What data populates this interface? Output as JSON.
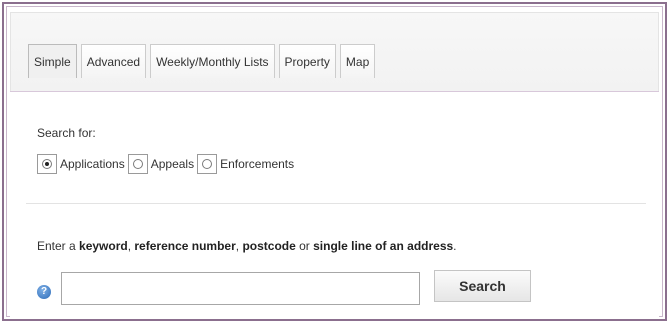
{
  "tabs": [
    {
      "label": "Simple",
      "active": true
    },
    {
      "label": "Advanced",
      "active": false
    },
    {
      "label": "Weekly/Monthly Lists",
      "active": false
    },
    {
      "label": "Property",
      "active": false
    },
    {
      "label": "Map",
      "active": false
    }
  ],
  "search_for": {
    "label": "Search for:",
    "options": [
      {
        "label": "Applications",
        "selected": true
      },
      {
        "label": "Appeals",
        "selected": false
      },
      {
        "label": "Enforcements",
        "selected": false
      }
    ]
  },
  "instructions": {
    "part1": "Enter a ",
    "keyword": "keyword",
    "part2": ", ",
    "reference": "reference number",
    "part3": ", ",
    "postcode": "postcode",
    "part4": " or ",
    "single_line": "single line of an address",
    "part5": "."
  },
  "search": {
    "value": "",
    "placeholder": "",
    "button_label": "Search",
    "help_icon": "help-icon"
  },
  "colors": {
    "frame_border": "#8b6f8e",
    "help_icon": "#2c6bb8"
  }
}
